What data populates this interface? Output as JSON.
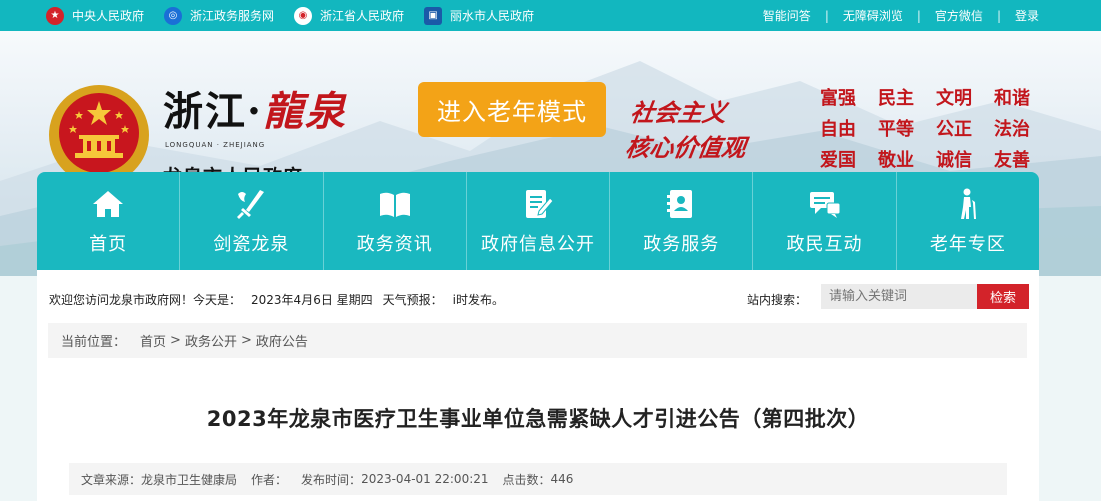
{
  "topbar": {
    "left_links": [
      {
        "label": "中央人民政府",
        "icon": "national-emblem-icon",
        "color": "#d3232a"
      },
      {
        "label": "浙江政务服务网",
        "icon": "zj-service-icon",
        "color": "#1a6fd6"
      },
      {
        "label": "浙江省人民政府",
        "icon": "zj-gov-icon",
        "color": "#d3232a"
      },
      {
        "label": "丽水市人民政府",
        "icon": "lishui-gov-icon",
        "color": "#1a5aa8"
      }
    ],
    "right_links": [
      "智能问答",
      "无障碍浏览",
      "官方微信",
      "登录"
    ],
    "separator": "|"
  },
  "banner": {
    "logo_text": "浙江·",
    "logo_script": "龍泉",
    "logo_en": "LONGQUAN · ZHEJIANG",
    "logo_cn": "龙泉市人民政府",
    "elder_mode_label": "进入老年模式",
    "calligraphy_line1": "社会主义",
    "calligraphy_line2": "核心价值观",
    "core_values": [
      "富强",
      "民主",
      "文明",
      "和谐",
      "自由",
      "平等",
      "公正",
      "法治",
      "爱国",
      "敬业",
      "诚信",
      "友善"
    ]
  },
  "nav": {
    "items": [
      {
        "label": "首页",
        "icon": "home-icon"
      },
      {
        "label": "剑瓷龙泉",
        "icon": "sword-icon"
      },
      {
        "label": "政务资讯",
        "icon": "book-icon"
      },
      {
        "label": "政府信息公开",
        "icon": "document-icon"
      },
      {
        "label": "政务服务",
        "icon": "contacts-icon"
      },
      {
        "label": "政民互动",
        "icon": "chat-icon"
      },
      {
        "label": "老年专区",
        "icon": "elderly-icon"
      }
    ]
  },
  "info": {
    "welcome": "欢迎您访问龙泉市政府网！今天是：",
    "date": "2023年4月6日 星期四",
    "weather_label": "天气预报：",
    "weather_text": "i时发布。",
    "search_label": "站内搜索：",
    "search_placeholder": "请输入关键词",
    "search_button": "检索"
  },
  "breadcrumb": {
    "label": "当前位置：",
    "items": [
      "首页",
      "政务公开",
      "政府公告"
    ],
    "separator": ">"
  },
  "article": {
    "title": "2023年龙泉市医疗卫生事业单位急需紧缺人才引进公告（第四批次）",
    "source_label": "文章来源：",
    "source": "龙泉市卫生健康局",
    "author_label": "作者：",
    "author": "",
    "time_label": "发布时间：",
    "time": "2023-04-01 22:00:21",
    "clicks_label": "点击数：",
    "clicks": "446"
  },
  "colors": {
    "topbar": "#12b7bf",
    "nav": "#1ab8c0",
    "accent_orange": "#f3a317",
    "accent_red": "#c2161c",
    "search_button": "#d3232a"
  }
}
